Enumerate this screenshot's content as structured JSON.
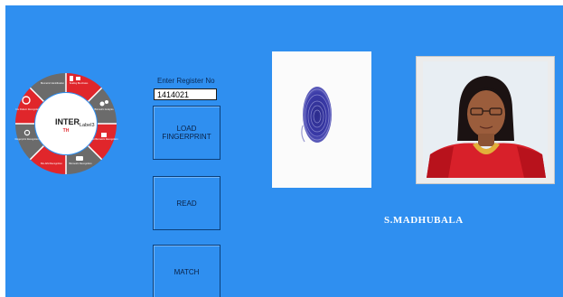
{
  "logo": {
    "center_text": "INTER",
    "center_subtext": "Label3",
    "segments": [
      "Scaling Bio-Rates",
      "Biometric Analysis",
      "Foot Biometric Recognition",
      "Biometric Recognition",
      "Bio-AIM Recognition",
      "Fingerprint Recognition",
      "Iris Pattern Recognition",
      "Biometric Identification"
    ]
  },
  "form": {
    "register_label": "Enter Register No",
    "register_value": "1414021"
  },
  "buttons": {
    "load_label": "LOAD\nFINGERPRINT",
    "read_label": "READ",
    "match_label": "MATCH"
  },
  "result": {
    "name": "S.MADHUBALA"
  },
  "colors": {
    "background": "#2f8ff0",
    "logo_red": "#e0262b",
    "logo_gray": "#6b6b6b"
  }
}
